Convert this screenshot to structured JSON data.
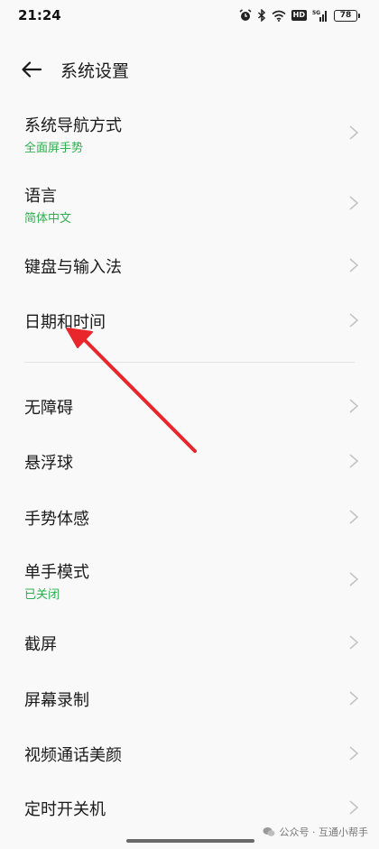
{
  "status_bar": {
    "time": "21:24",
    "hd": "HD",
    "signal": "5G",
    "battery": "78",
    "icons": [
      "alarm-icon",
      "bluetooth-icon",
      "wifi-icon",
      "hd-icon",
      "signal-icon",
      "battery-icon"
    ]
  },
  "header": {
    "back_icon": "arrow-left-icon",
    "title": "系统设置"
  },
  "items": [
    {
      "title": "系统导航方式",
      "subtitle": "全面屏手势"
    },
    {
      "title": "语言",
      "subtitle": "简体中文"
    },
    {
      "title": "键盘与输入法"
    },
    {
      "title": "日期和时间"
    },
    {
      "title": "无障碍"
    },
    {
      "title": "悬浮球"
    },
    {
      "title": "手势体感"
    },
    {
      "title": "单手模式",
      "subtitle": "已关闭"
    },
    {
      "title": "截屏"
    },
    {
      "title": "屏幕录制"
    },
    {
      "title": "视频通话美颜"
    },
    {
      "title": "定时开关机"
    }
  ],
  "colors": {
    "subtitle_green": "#2eaf4f",
    "annotation_red": "#e8262b"
  },
  "watermark": {
    "text": "公众号 · 互通小帮手"
  }
}
